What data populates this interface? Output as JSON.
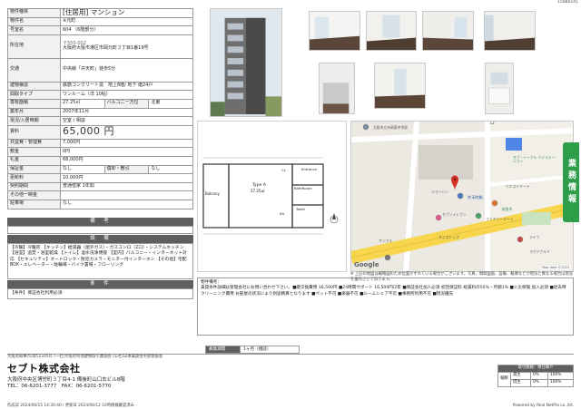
{
  "doc_id": "15886541",
  "property": {
    "type_label": "物件種目",
    "type_value": "[住居用] マンション",
    "name_label": "物件名",
    "name_value": "※元町",
    "room_label": "号室名",
    "room_value": "604 （6階部分）",
    "address_label": "所在地",
    "address_postal": "〒550-002",
    "address_value": "大阪府大阪市港区市岡元町３丁目1番19号",
    "access_label": "交通",
    "access_value": "中央線「弁天町」徒歩5分",
    "structure_label": "建物構造",
    "structure_value": "鉄筋コンクリート造　地上8階/ 地下 階24戸",
    "layout_label": "間取タイプ",
    "layout_value": "ワンルーム（洋 10帖）",
    "area_label": "専有面積",
    "area_value": "27.25㎡",
    "balcony_label": "バルコニー方位",
    "balcony_value": "北東",
    "built_label": "築年月",
    "built_value": "2007年11月",
    "status_label": "現況/入居時期",
    "status_value": "空室 / 相談",
    "rent_label": "賃料",
    "rent_value": "65,000 円",
    "fee_label": "共益費・管理費",
    "fee_value": "7,000円",
    "deposit_label": "敷金",
    "deposit_value": "0円",
    "key_label": "礼金",
    "key_value": "68,000円",
    "guarantee_label": "保証金",
    "guarantee_value": "なし",
    "amortize_label": "償却・敷引",
    "amortize_value": "なし",
    "renewal_label": "更新料",
    "renewal_value": "10,000円",
    "contract_label": "契約期間",
    "contract_value": "普通借家 1年間",
    "other_label": "その他一時金",
    "other_value": "",
    "parking_label": "駐車場",
    "parking_value": "なし"
  },
  "remarks_band": "備　考",
  "facilities_band": "設　備",
  "facilities_text": "【冷暖】冷暖房 【キッチン】給湯器（屋外ガス）・ガスコンロ（2口）・システムキッチン 【浴室】追焚・浴室乾燥 【トイレ】温水洗浄便座 【室内】バルコニー・インターネット対応 【セキュリティ】オートロック・防犯カメラ・モニター付インターホン 【その他】宅配BOX・エレベーター・駐輪場・バイク置場・フローリング",
  "conditions_band": "条　件",
  "conditions_text": "【条件】保証会社利用必須",
  "photos": [
    "外観",
    "室内",
    "室内",
    "室内",
    "室内",
    "キッチン",
    "室内",
    "洗面所"
  ],
  "floorplan": {
    "balcony": "Balcony",
    "room": "Type A",
    "room_area": "27.25㎡",
    "entrance": "Entrance",
    "bath": "BathRoom",
    "toilet": "Toilet",
    "kitchen": "Kit",
    "closet": "CL"
  },
  "map": {
    "labels": [
      "大阪市立市岡東中学校",
      "セブ・トーナル ベイステーション",
      "ジョーシン",
      "弁天町駅",
      "ファミリーマート",
      "桜並木",
      "ウエストヤード",
      "セブンイレブン",
      "サンクス",
      "ミニストップ",
      "ライフ",
      "マクドナルド"
    ],
    "logo": "Google",
    "credit": "Map data ©2024",
    "number": "12"
  },
  "map_note": "※ 上記の地図は概略図のため位置がずれている場合がございます。写真、間取図面、設備、概要などが現況と異なる場合は現況を優先させて頂きます。",
  "remarks_title": "物件備考：",
  "remarks_text": "賃貸条件詳細は管理会社にお問い合わせ下さい。■鍵交換費用 16,500円 ■24時間サポート 16,500円/2年 ■保証会社加入必須 初回保証料 総賃料の50%・月額1% ■火災保険 加入必須 ■退去時クリーニング費用 お部屋の状況により別途精算となります ■ペット不可 ■楽器不可 ■ルームシェア不可 ■事務所利用不可 ■現況優先",
  "period_label": "募集期間",
  "period_value": "1ヶ月（相談）",
  "footer": {
    "license": "大阪府知事(5)第52345号 (一社)大阪府宅地建物取引業協会 (公社)日本賃貸住宅管理協会",
    "company": "セブト株式会社",
    "address": "大阪府中央区博労町３丁目4-1 備後町山口玄ビル8階",
    "tel": "TEL：06-6201-3777　FAX：06-6201-5770",
    "created": "作成日 2024/06/15 14:30:40 / 更新日 2024/06/12 16時情報確認済み",
    "powered": "Powered by Real NetPro co.,ltd."
  },
  "broker": {
    "header": "取引態様：専任媒介",
    "fee_label": "報酬",
    "rows": [
      [
        "貸主",
        "0%",
        "借主",
        "100%"
      ],
      [
        "借主",
        "0%",
        "借主",
        "100%"
      ]
    ]
  },
  "side_tab": "業務情報"
}
